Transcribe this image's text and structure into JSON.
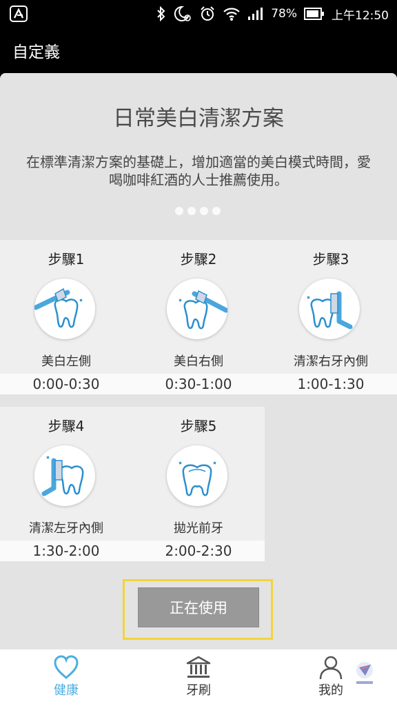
{
  "status_bar": {
    "battery_percent": "78%",
    "time": "上午12:50",
    "icons": [
      "app-icon",
      "bluetooth-icon",
      "do-not-disturb-moon-icon",
      "alarm-clock-icon",
      "wifi-icon",
      "signal-icon",
      "battery-icon"
    ]
  },
  "app_bar": {
    "title": "自定義"
  },
  "plan": {
    "title": "日常美白清潔方案",
    "description": "在標準清潔方案的基礎上，增加適當的美白模式時間，愛喝咖啡紅酒的人士推薦使用。",
    "page_dots": 4
  },
  "steps": [
    {
      "label": "步驟1",
      "name": "美白左側",
      "time": "0:00-0:30",
      "icon": "tooth-brush-left-icon"
    },
    {
      "label": "步驟2",
      "name": "美白右側",
      "time": "0:30-1:00",
      "icon": "tooth-brush-right-icon"
    },
    {
      "label": "步驟3",
      "name": "清潔右牙內側",
      "time": "1:00-1:30",
      "icon": "tooth-brush-inner-right-icon"
    },
    {
      "label": "步驟4",
      "name": "清潔左牙內側",
      "time": "1:30-2:00",
      "icon": "tooth-brush-inner-left-icon"
    },
    {
      "label": "步驟5",
      "name": "拋光前牙",
      "time": "2:00-2:30",
      "icon": "tooth-polish-icon"
    }
  ],
  "button": {
    "label": "正在使用"
  },
  "nav": [
    {
      "label": "健康",
      "icon": "heart-icon",
      "active": true
    },
    {
      "label": "牙刷",
      "icon": "toothbrush-bank-icon",
      "active": false
    },
    {
      "label": "我的",
      "icon": "user-icon",
      "active": false
    }
  ],
  "colors": {
    "accent": "#4aaee0",
    "tooth_outline": "#2a8fcf",
    "brush_blue": "#4aa6dd",
    "button_gray": "#999999",
    "highlight_yellow": "#f2d43a"
  }
}
